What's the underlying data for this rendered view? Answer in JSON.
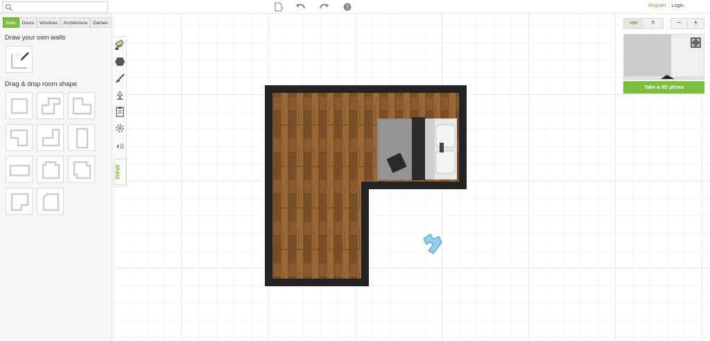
{
  "search": {
    "placeholder": ""
  },
  "toolbar": {
    "icons": [
      "file-menu-icon",
      "undo-icon",
      "redo-icon",
      "help-icon"
    ]
  },
  "auth": {
    "register": "Register",
    "separator": "|",
    "login": "Login"
  },
  "sidebar": {
    "tabs": [
      "Walls",
      "Doors",
      "Windows",
      "Architecture",
      "Garden"
    ],
    "active_tab": "Walls",
    "draw_title": "Draw your own walls",
    "shapes_title": "Drag & drop room shape"
  },
  "vertical_toolbar": {
    "icons": [
      "paint-roller-icon",
      "floor-icon",
      "brush-icon",
      "light-icon",
      "clipboard-icon",
      "gear-icon",
      "collapse-icon"
    ],
    "new_label": "new"
  },
  "units": {
    "options": [
      "mtr",
      "ft"
    ],
    "selected": "mtr"
  },
  "zoom": {
    "out": "−",
    "in": "+"
  },
  "photo_button": "Take a 3D photo",
  "colors": {
    "accent": "#7cbf3f",
    "wall": "#232323",
    "floor": "#8a5a2e",
    "canvas_grid": "#e9e9e9"
  }
}
